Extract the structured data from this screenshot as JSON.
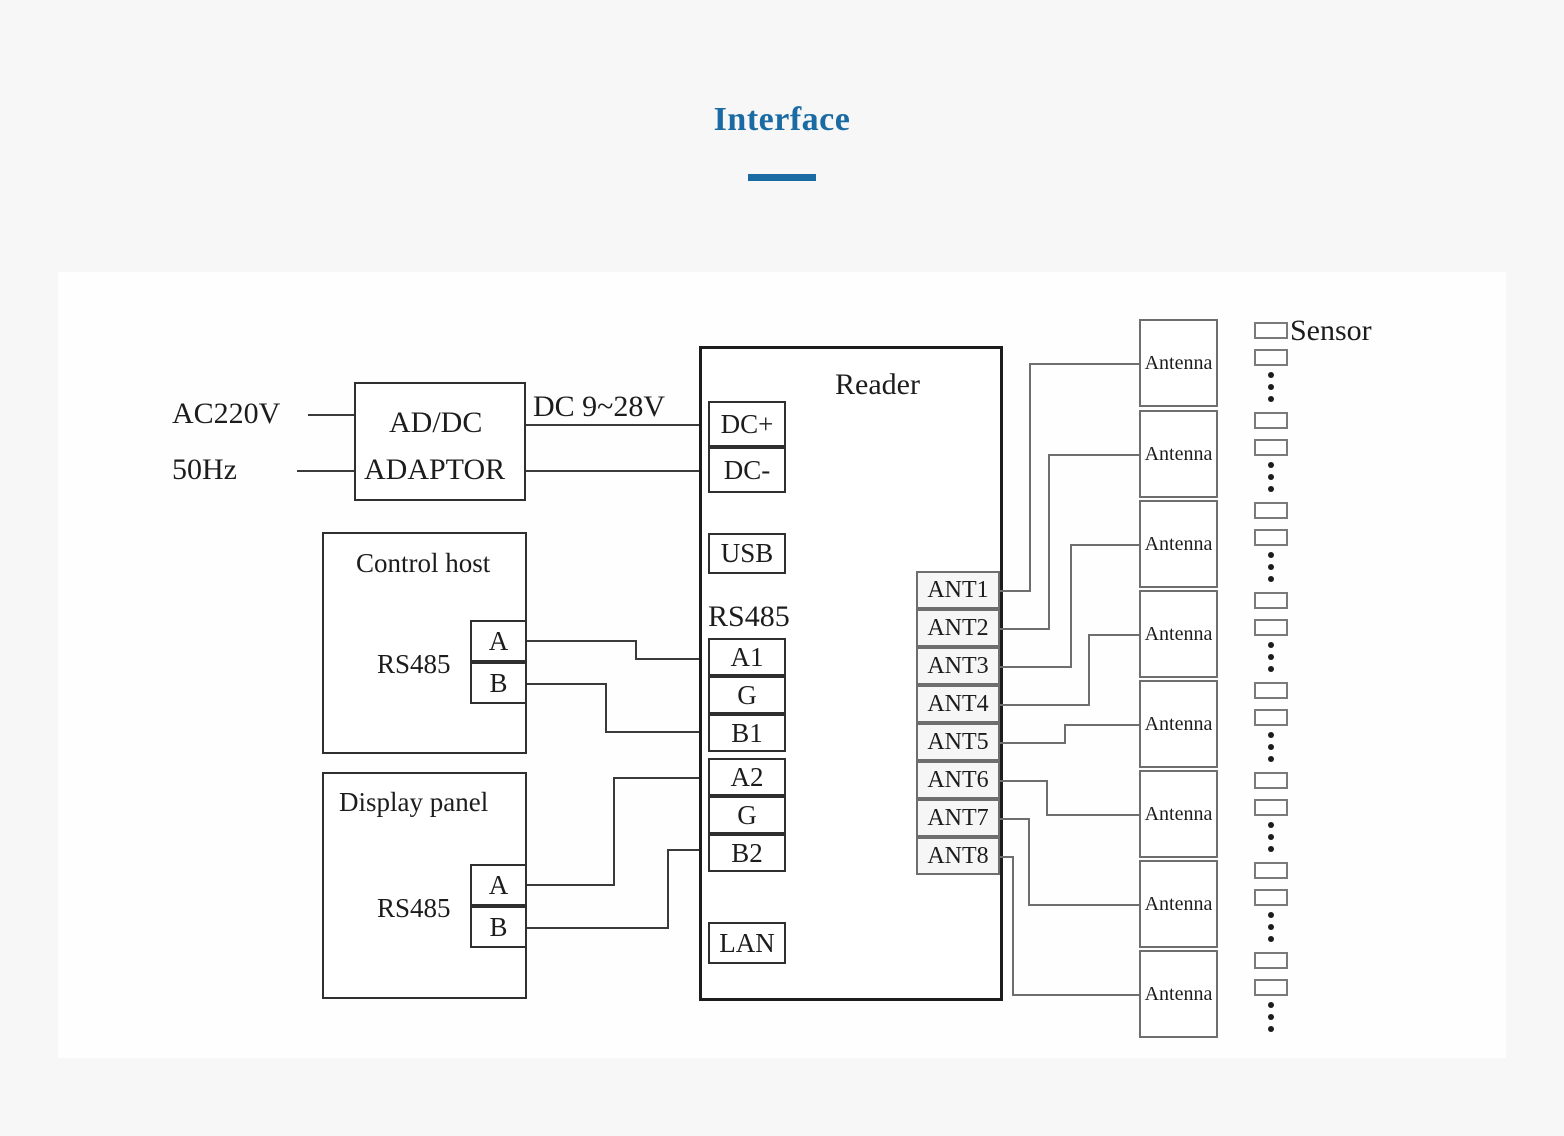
{
  "title": {
    "text": "Interface",
    "accent_color": "#1a6ba3"
  },
  "diagram": {
    "type": "block-wiring-diagram",
    "power": {
      "source_line1": "AC220V",
      "source_line2": "50Hz",
      "adaptor_line1": "AD/DC",
      "adaptor_line2": "ADAPTOR",
      "output_label": "DC 9~28V"
    },
    "control_host": {
      "title": "Control host",
      "bus_label": "RS485",
      "ports": [
        "A",
        "B"
      ]
    },
    "display_panel": {
      "title": "Display panel",
      "bus_label": "RS485",
      "ports": [
        "A",
        "B"
      ]
    },
    "reader": {
      "title": "Reader",
      "power_ports": [
        "DC+",
        "DC-"
      ],
      "usb_port": "USB",
      "rs485_label": "RS485",
      "rs485_ports_1": [
        "A1",
        "G",
        "B1"
      ],
      "rs485_ports_2": [
        "A2",
        "G",
        "B2"
      ],
      "lan_port": "LAN",
      "ant_ports": [
        "ANT1",
        "ANT2",
        "ANT3",
        "ANT4",
        "ANT5",
        "ANT6",
        "ANT7",
        "ANT8"
      ]
    },
    "antennas": [
      {
        "label": "Antenna"
      },
      {
        "label": "Antenna"
      },
      {
        "label": "Antenna"
      },
      {
        "label": "Antenna"
      },
      {
        "label": "Antenna"
      },
      {
        "label": "Antenna"
      },
      {
        "label": "Antenna"
      },
      {
        "label": "Antenna"
      }
    ],
    "sensor": {
      "label": "Sensor",
      "groups": 8,
      "per_group_rects": 2,
      "continuation_dots": 3
    }
  }
}
